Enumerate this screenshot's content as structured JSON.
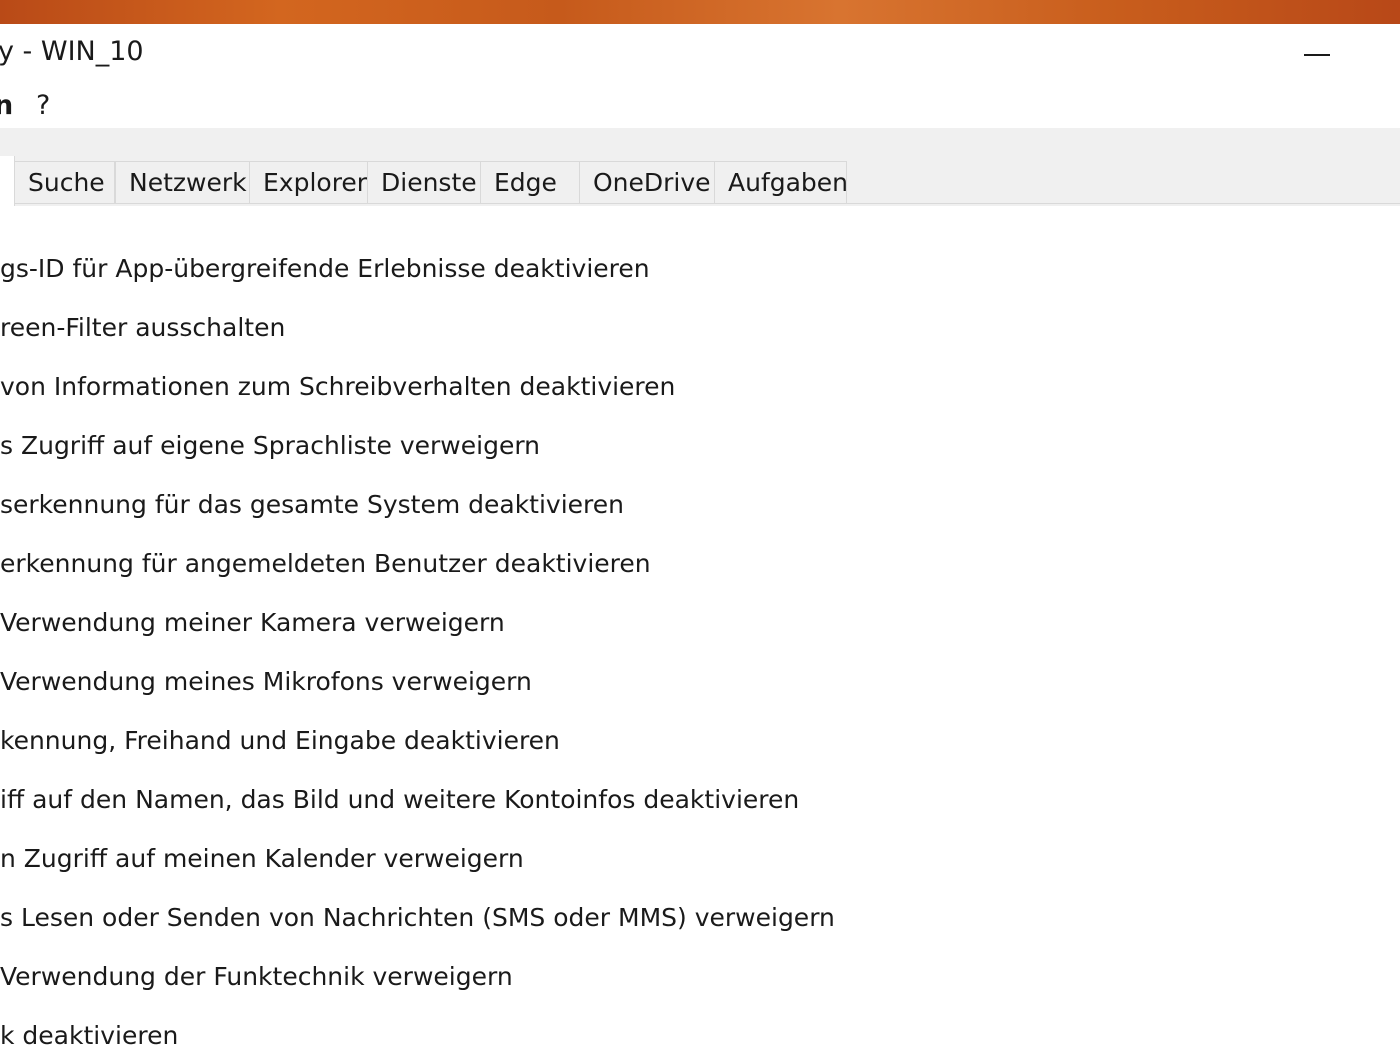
{
  "window": {
    "title": "y - WIN_10",
    "minimize_icon": "minimize-icon"
  },
  "menu": {
    "items": [
      {
        "label": "n"
      },
      {
        "label": "?"
      }
    ]
  },
  "tabs": [
    {
      "label": "Suche"
    },
    {
      "label": "Netzwerk"
    },
    {
      "label": "Explorer"
    },
    {
      "label": "Dienste"
    },
    {
      "label": "Edge"
    },
    {
      "label": "OneDrive"
    },
    {
      "label": "Aufgaben"
    }
  ],
  "options": [
    {
      "label": "gs-ID für App-übergreifende Erlebnisse deaktivieren"
    },
    {
      "label": "reen-Filter ausschalten"
    },
    {
      "label": "von Informationen zum Schreibverhalten deaktivieren"
    },
    {
      "label": "s Zugriff auf eigene Sprachliste verweigern"
    },
    {
      "label": "serkennung für das gesamte System deaktivieren"
    },
    {
      "label": "erkennung für angemeldeten Benutzer deaktivieren"
    },
    {
      "label": " Verwendung meiner Kamera verweigern"
    },
    {
      "label": " Verwendung meines Mikrofons verweigern"
    },
    {
      "label": "kennung, Freihand und Eingabe deaktivieren"
    },
    {
      "label": "iff auf den Namen, das Bild und weitere Kontoinfos deaktivieren"
    },
    {
      "label": "n Zugriff auf meinen Kalender verweigern"
    },
    {
      "label": "s Lesen oder Senden von Nachrichten (SMS oder MMS) verweigern"
    },
    {
      "label": " Verwendung der Funktechnik verweigern"
    },
    {
      "label": "k deaktivieren"
    }
  ]
}
